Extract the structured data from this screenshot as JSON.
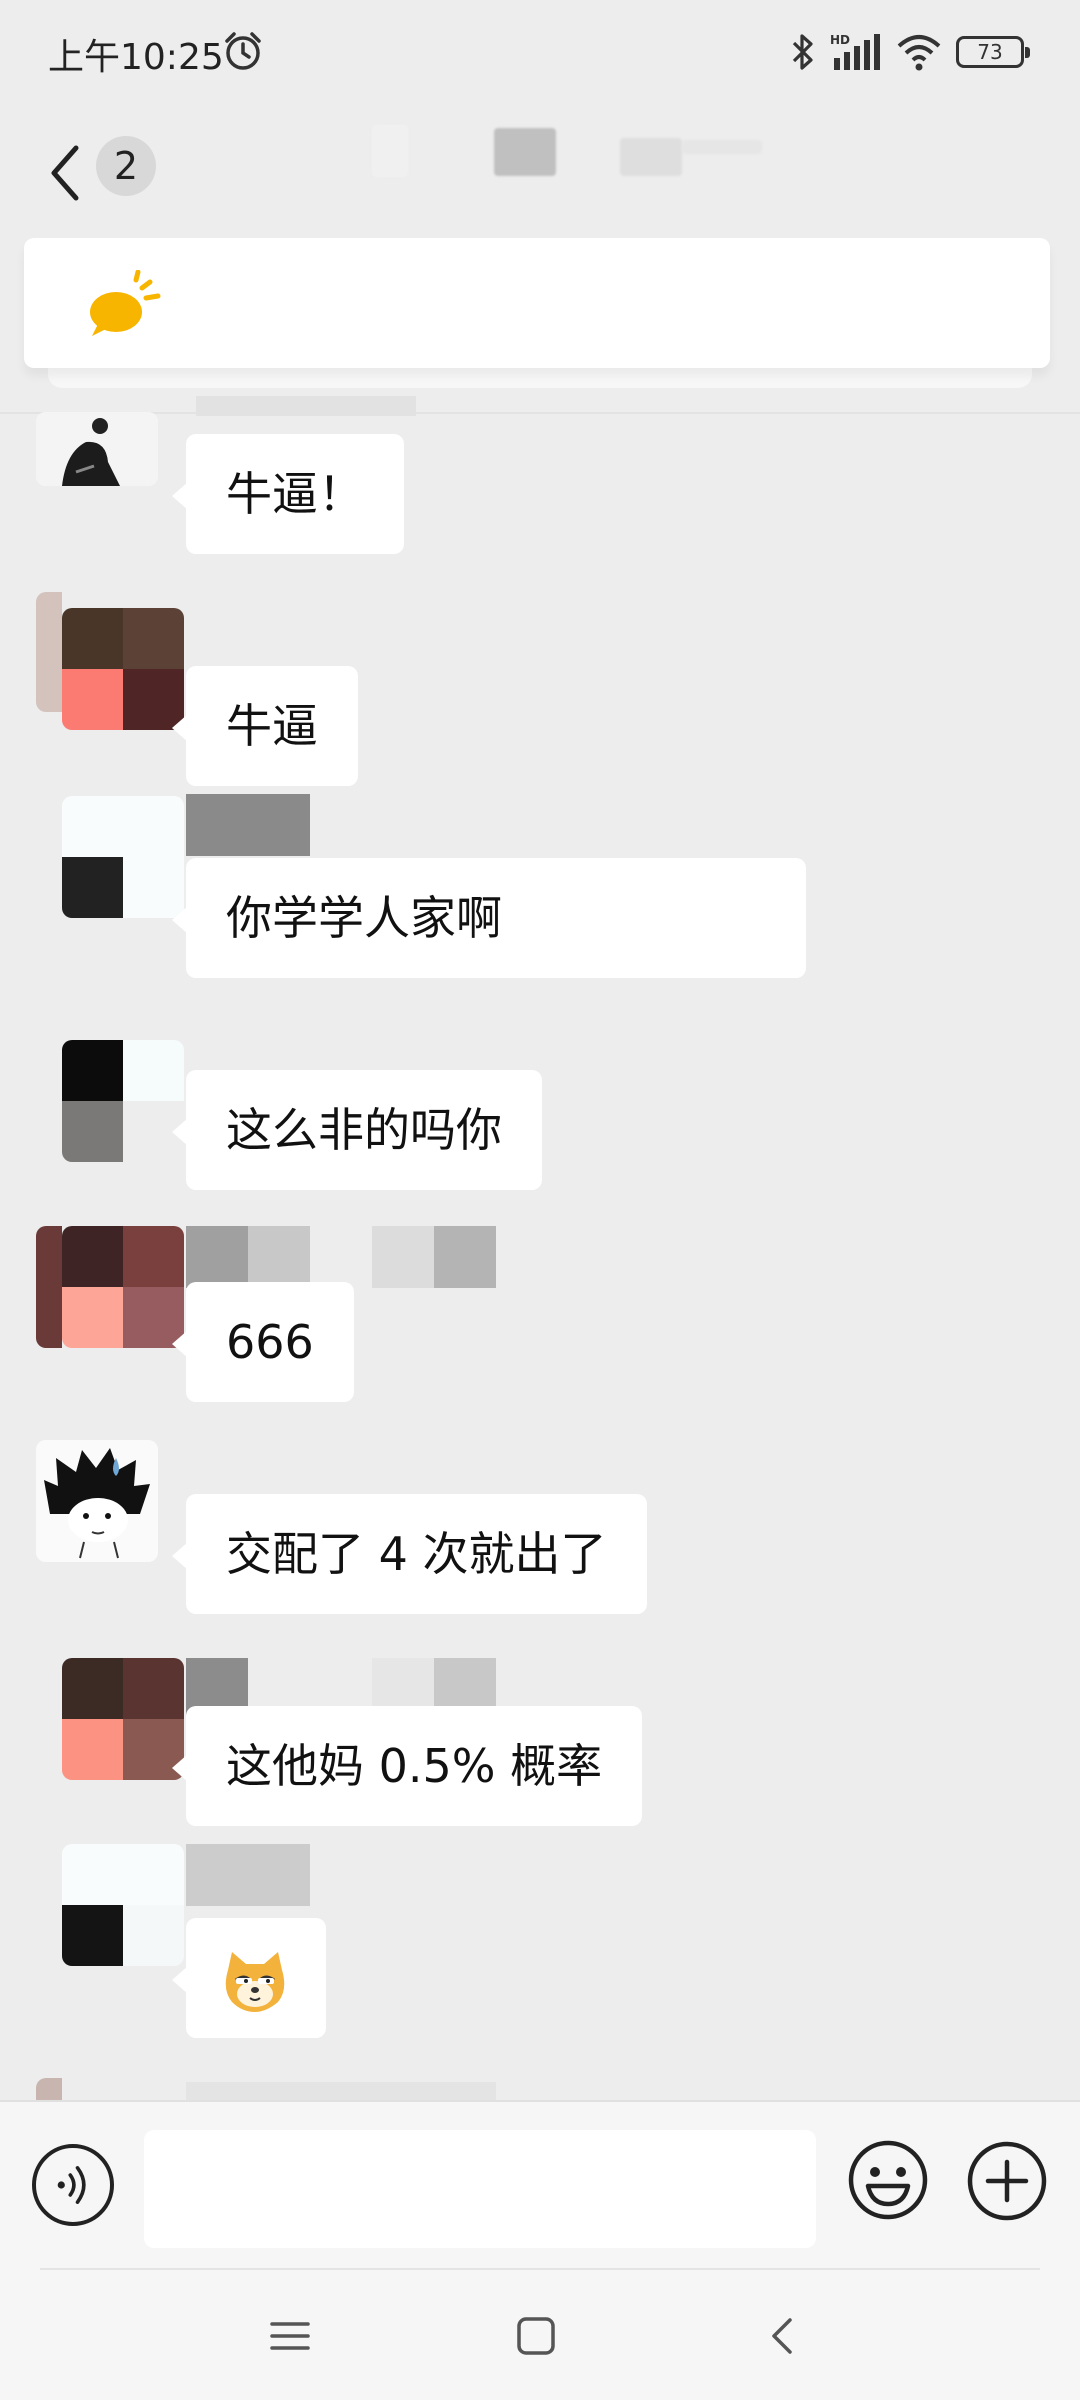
{
  "status_bar": {
    "time": "上午10:25",
    "battery": "73",
    "icons": [
      "alarm-icon",
      "bluetooth-icon",
      "hd-signal-icon",
      "wifi-icon",
      "battery-icon"
    ]
  },
  "header": {
    "unread_count": "2",
    "back_icon": "chevron-left-icon"
  },
  "notice": {
    "icon": "speech-bubble-icon",
    "accent": "#f7b500"
  },
  "messages": [
    {
      "text": "牛逼！",
      "type": "text"
    },
    {
      "text": "牛逼",
      "type": "text"
    },
    {
      "text": "你学学人家啊",
      "type": "text"
    },
    {
      "text": "这么非的吗你",
      "type": "text"
    },
    {
      "text": "666",
      "type": "text"
    },
    {
      "text": "交配了 4 次就出了",
      "type": "text"
    },
    {
      "text": "这他妈 0.5% 概率",
      "type": "text"
    },
    {
      "text": "",
      "type": "emoji",
      "icon": "doge-emoji-icon"
    }
  ],
  "input_bar": {
    "voice_icon": "voice-icon",
    "emoji_icon": "smiley-icon",
    "plus_icon": "plus-icon",
    "placeholder": ""
  },
  "nav_bar": {
    "icons": [
      "menu-icon",
      "home-icon",
      "back-icon"
    ]
  },
  "colors": {
    "background": "#ededed",
    "bubble": "#ffffff",
    "accent": "#f7b500"
  }
}
